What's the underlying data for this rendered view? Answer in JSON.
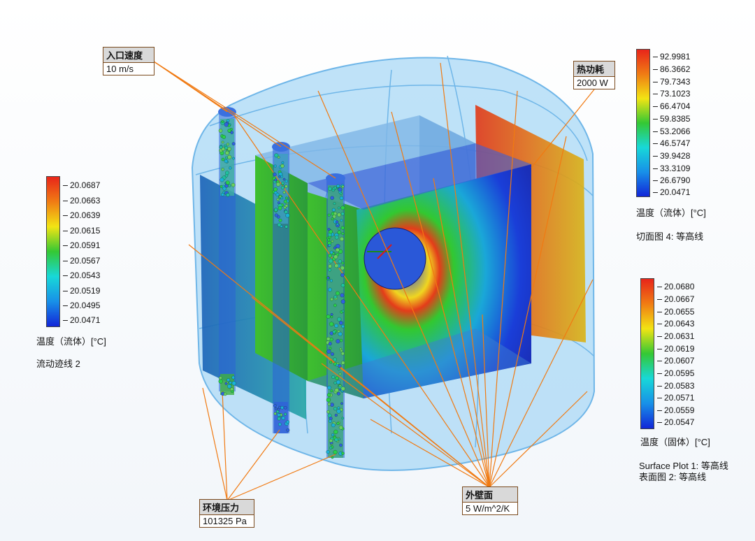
{
  "callouts": {
    "inlet": {
      "title": "入口速度",
      "value": "10 m/s"
    },
    "heat": {
      "title": "热功耗",
      "value": "2000 W"
    },
    "pressure": {
      "title": "环境压力",
      "value": "101325 Pa"
    },
    "wall": {
      "title": "外壁面",
      "value": "5 W/m^2/K"
    }
  },
  "legend_left": {
    "ticks": [
      "20.0687",
      "20.0663",
      "20.0639",
      "20.0615",
      "20.0591",
      "20.0567",
      "20.0543",
      "20.0519",
      "20.0495",
      "20.0471"
    ],
    "title": "温度（流体）[°C]",
    "subtitle": "流动迹线 2"
  },
  "legend_right_top": {
    "ticks": [
      "92.9981",
      "86.3662",
      "79.7343",
      "73.1023",
      "66.4704",
      "59.8385",
      "53.2066",
      "46.5747",
      "39.9428",
      "33.3109",
      "26.6790",
      "20.0471"
    ],
    "title": "温度（流体）[°C]",
    "subtitle": "切面图 4: 等高线"
  },
  "legend_right_bottom": {
    "ticks": [
      "20.0680",
      "20.0667",
      "20.0655",
      "20.0643",
      "20.0631",
      "20.0619",
      "20.0607",
      "20.0595",
      "20.0583",
      "20.0571",
      "20.0559",
      "20.0547"
    ],
    "title": "温度（固体）[°C]",
    "subtitle1": "Surface Plot 1: 等高线",
    "subtitle2": "表面图 2: 等高线"
  },
  "colors": {
    "accent_leader": "#f07a12",
    "enclosure": "#9fd3f5",
    "hot": "#e0261a",
    "cold": "#1a2fd0"
  }
}
